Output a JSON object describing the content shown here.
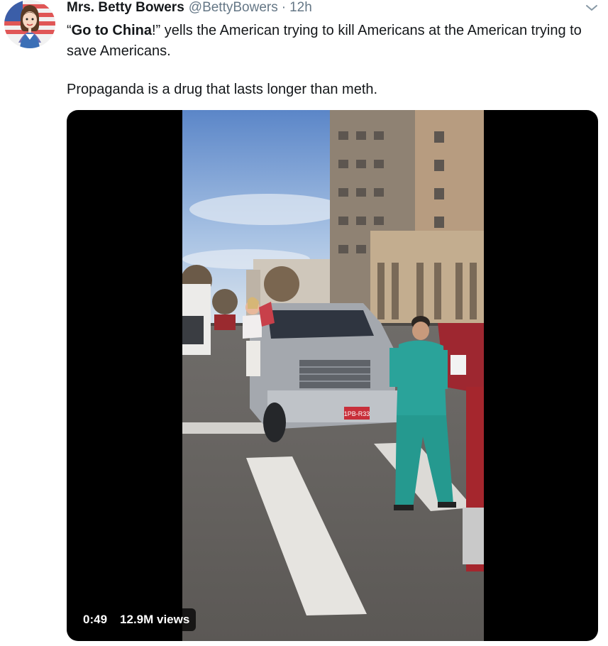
{
  "tweet": {
    "author_name": "Mrs. Betty Bowers",
    "handle": "@BettyBowers",
    "separator": "·",
    "time": "12h",
    "text_quote": "Go to China",
    "text_open_quote": "“",
    "text_close": "!” yells the American trying to kill Americans at the American trying to save Americans.",
    "text_line2": "Propaganda is a drug that lasts longer than meth."
  },
  "video": {
    "duration": "0:49",
    "views": "12.9M views"
  },
  "icons": {
    "avatar": "cartoon-woman-flag-avatar",
    "caret": "chevron-down-icon",
    "license_plate": "1PB-R33"
  },
  "colors": {
    "text_primary": "#14171a",
    "text_secondary": "#657786",
    "video_background": "#000000",
    "scrub_green": "#2aa39a"
  }
}
